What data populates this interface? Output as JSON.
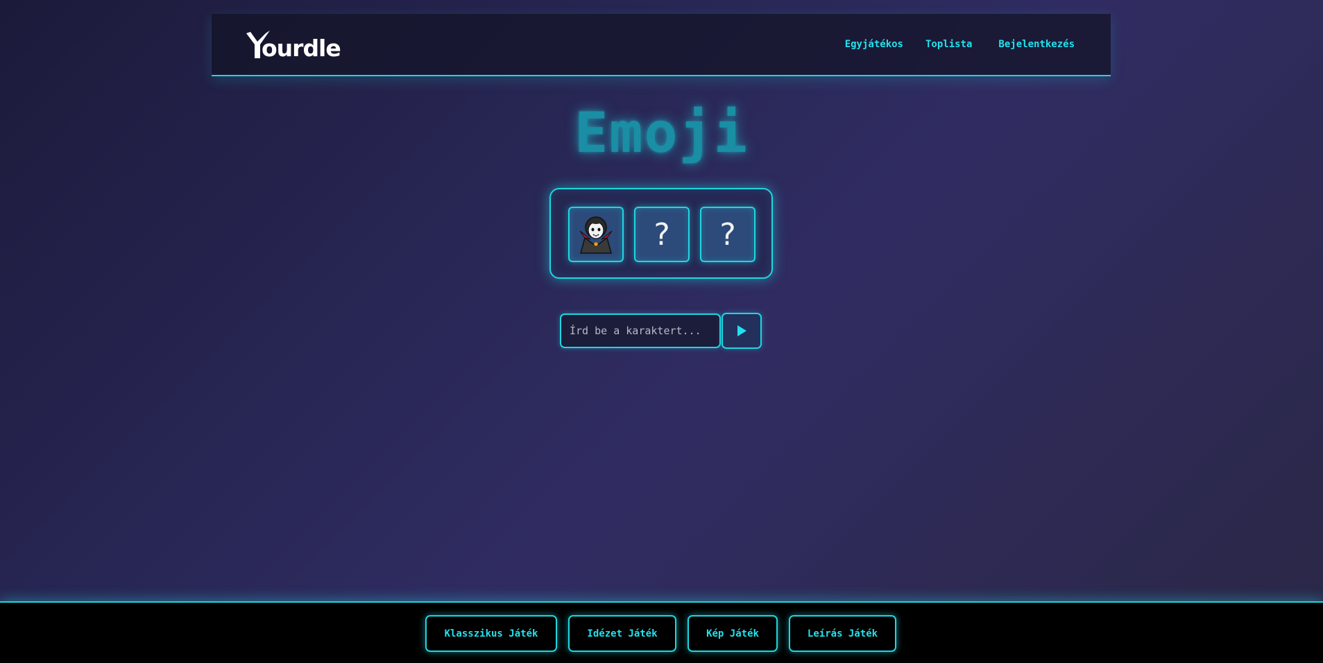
{
  "header": {
    "logo_text": "ourdle",
    "nav": [
      "Egyjátékos",
      "Toplista",
      "Bejelentkezés"
    ]
  },
  "main": {
    "title": "Emoji",
    "emoji_slots": [
      {
        "icon": "vampire-emoji",
        "revealed": true,
        "text": ""
      },
      {
        "icon": "",
        "revealed": false,
        "text": "?"
      },
      {
        "icon": "",
        "revealed": false,
        "text": "?"
      }
    ],
    "input": {
      "placeholder": "Írd be a karaktert...",
      "value": ""
    },
    "submit_icon": "play-icon"
  },
  "footer": {
    "buttons": [
      "Klasszikus Játék",
      "Idézet Játék",
      "Kép Játék",
      "Leírás Játék"
    ]
  },
  "colors": {
    "accent": "#1fd7e0",
    "nav_text": "#22e2ee",
    "title": "#1a8ea4"
  }
}
